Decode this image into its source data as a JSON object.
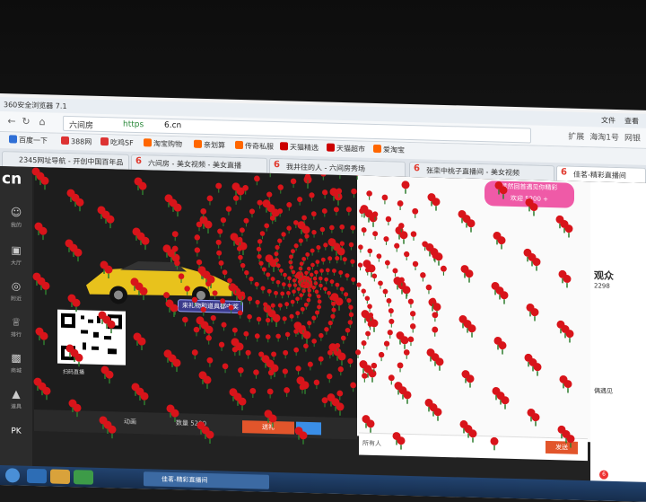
{
  "browser": {
    "title": "360安全浏览器 7.1",
    "menu": [
      "文件",
      "查看"
    ],
    "address": {
      "site": "六间房",
      "protocol": "https",
      "domain": "6.cn"
    },
    "toolbar_right": [
      "扩展",
      "海淘1号",
      "网银"
    ]
  },
  "bookmarks": [
    {
      "label": "百度一下",
      "color": "#2f6fd6"
    },
    {
      "label": "388网",
      "color": "#d33"
    },
    {
      "label": "吃鸡SF",
      "color": "#d33"
    },
    {
      "label": "淘宝购物",
      "color": "#f60"
    },
    {
      "label": "亲划算",
      "color": "#f60"
    },
    {
      "label": "传奇私服",
      "color": "#f60"
    },
    {
      "label": "天猫精选",
      "color": "#c00"
    },
    {
      "label": "天猫超市",
      "color": "#c00"
    },
    {
      "label": "爱淘宝",
      "color": "#f60"
    }
  ],
  "tabs": [
    {
      "label": "2345网址导航 - 开创中国百年品"
    },
    {
      "label": "六间房 - 美女视频 - 美女直播"
    },
    {
      "label": "我井往的人 - 六间房秀场"
    },
    {
      "label": "张栾中桃子直播间 - 美女视频"
    },
    {
      "label": "佳茗-精彩直播间"
    }
  ],
  "site": {
    "logo": "cn",
    "nav": [
      {
        "label": "我的",
        "icon": "user-icon"
      },
      {
        "label": "大厅",
        "icon": "tv-icon"
      },
      {
        "label": "附近",
        "icon": "compass-icon"
      },
      {
        "label": "排行",
        "icon": "crown-icon"
      },
      {
        "label": "商城",
        "icon": "bag-icon"
      },
      {
        "label": "道具",
        "icon": "shirt-icon"
      },
      {
        "label": "PK",
        "icon": "pk-icon"
      }
    ],
    "caption": "来礼物和道具都中奖",
    "qr_caption": "扫码直播",
    "popup": {
      "line1": "猛然回首遇见你精彩",
      "line2": "欢迎 5200 +"
    },
    "bottom": {
      "gift_label": "动画",
      "count_label": "数量 5200",
      "send_gift": "送礼",
      "chat_target": "所有人",
      "send": "发送"
    },
    "right_panel": [
      "观众",
      "2298",
      "偶遇见"
    ]
  },
  "taskbar": {
    "window_label": "佳茗-精彩直播间",
    "badge": "6"
  }
}
